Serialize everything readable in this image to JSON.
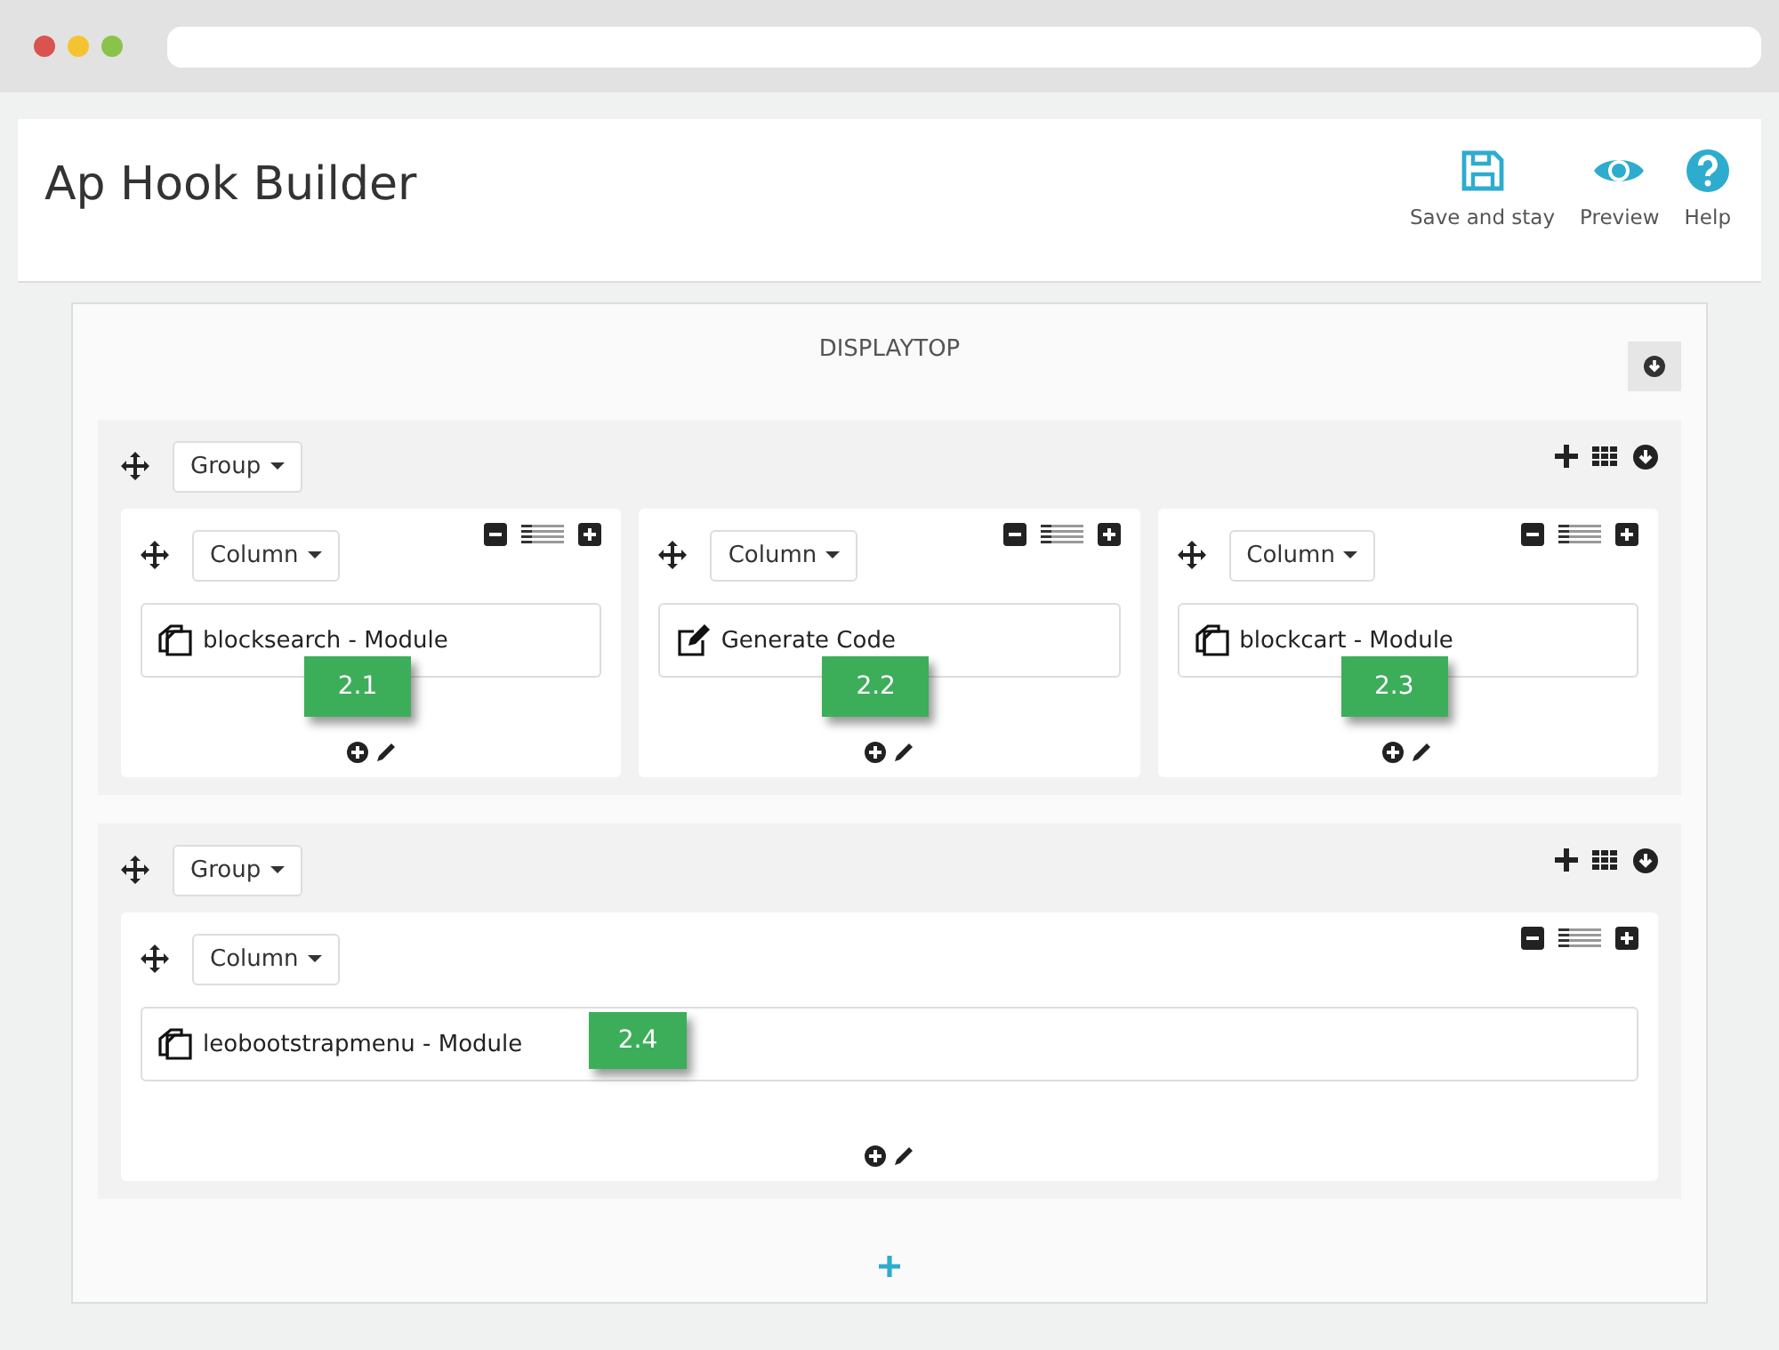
{
  "header": {
    "title": "Ap Hook Builder",
    "actions": [
      {
        "kind": "save",
        "label": "Save and stay"
      },
      {
        "kind": "preview",
        "label": "Preview"
      },
      {
        "kind": "help",
        "label": "Help"
      }
    ]
  },
  "hook": {
    "name": "DISPLAYTOP"
  },
  "groups": [
    {
      "label": "Group",
      "columns": [
        {
          "label": "Column",
          "module": {
            "kind": "module",
            "text": "blocksearch - Module"
          },
          "badge": "2.1"
        },
        {
          "label": "Column",
          "module": {
            "kind": "code",
            "text": "Generate Code"
          },
          "badge": "2.2"
        },
        {
          "label": "Column",
          "module": {
            "kind": "module",
            "text": "blockcart - Module"
          },
          "badge": "2.3"
        }
      ]
    },
    {
      "label": "Group",
      "columns": [
        {
          "label": "Column",
          "module": {
            "kind": "module",
            "text": "leobootstrapmenu - Module"
          },
          "badge": "2.4"
        }
      ]
    }
  ]
}
